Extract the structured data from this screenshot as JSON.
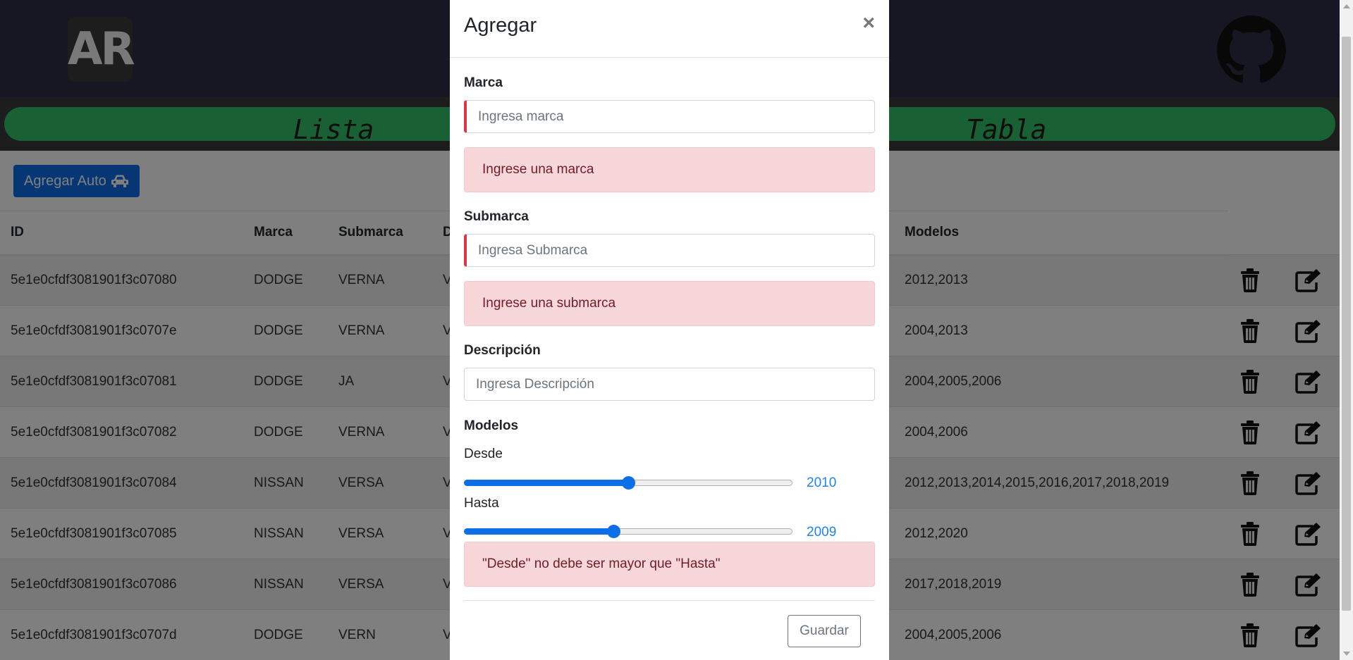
{
  "header": {
    "logo_text": "AR",
    "github_icon": "github-icon"
  },
  "nav": {
    "lista_label": "Lista",
    "tabla_label": "Tabla"
  },
  "toolbar": {
    "add_label": "Agregar Auto",
    "add_icon": "car-icon"
  },
  "table": {
    "columns": [
      "ID",
      "Marca",
      "Submarca",
      "De",
      "Modelos"
    ],
    "rows": [
      {
        "id": "5e1e0cfdf3081901f3c07080",
        "marca": "DODGE",
        "submarca": "VERNA",
        "desc": "VE",
        "modelos": "2012,2013"
      },
      {
        "id": "5e1e0cfdf3081901f3c0707e",
        "marca": "DODGE",
        "submarca": "VERNA",
        "desc": "VE",
        "modelos": "2004,2013"
      },
      {
        "id": "5e1e0cfdf3081901f3c07081",
        "marca": "DODGE",
        "submarca": "JA",
        "desc": "VE",
        "modelos": "2004,2005,2006"
      },
      {
        "id": "5e1e0cfdf3081901f3c07082",
        "marca": "DODGE",
        "submarca": "VERNA",
        "desc": "VE",
        "modelos": "2004,2006"
      },
      {
        "id": "5e1e0cfdf3081901f3c07084",
        "marca": "NISSAN",
        "submarca": "VERSA",
        "desc": "VE",
        "modelos": "2012,2013,2014,2015,2016,2017,2018,2019"
      },
      {
        "id": "5e1e0cfdf3081901f3c07085",
        "marca": "NISSAN",
        "submarca": "VERSA",
        "desc": "VE",
        "modelos": "2012,2020"
      },
      {
        "id": "5e1e0cfdf3081901f3c07086",
        "marca": "NISSAN",
        "submarca": "VERSA",
        "desc": "VE",
        "modelos": "2017,2018,2019"
      },
      {
        "id": "5e1e0cfdf3081901f3c0707d",
        "marca": "DODGE",
        "submarca": "VERN",
        "desc": "VE",
        "modelos": "2004,2005,2006"
      }
    ],
    "row_icons": [
      "trash-icon",
      "edit-icon"
    ]
  },
  "modal": {
    "title": "Agregar",
    "close": "×",
    "marca": {
      "label": "Marca",
      "placeholder": "Ingresa marca",
      "error": "Ingrese una marca"
    },
    "submarca": {
      "label": "Submarca",
      "placeholder": "Ingresa Submarca",
      "error": "Ingrese una submarca"
    },
    "descripcion": {
      "label": "Descripción",
      "placeholder": "Ingresa Descripción"
    },
    "modelos": {
      "label": "Modelos",
      "desde": {
        "label": "Desde",
        "value": "2010",
        "fraction": 0.5
      },
      "hasta": {
        "label": "Hasta",
        "value": "2009",
        "fraction": 0.455
      },
      "error": "\"Desde\" no debe ser mayor que \"Hasta\""
    },
    "save_label": "Guardar"
  },
  "colors": {
    "primary": "#0d6fe8",
    "nav_green": "#33c26b",
    "header_dark": "#2d2e44",
    "alert_bg": "#f8d7da",
    "alert_text": "#721c24",
    "invalid": "#dc3545"
  }
}
